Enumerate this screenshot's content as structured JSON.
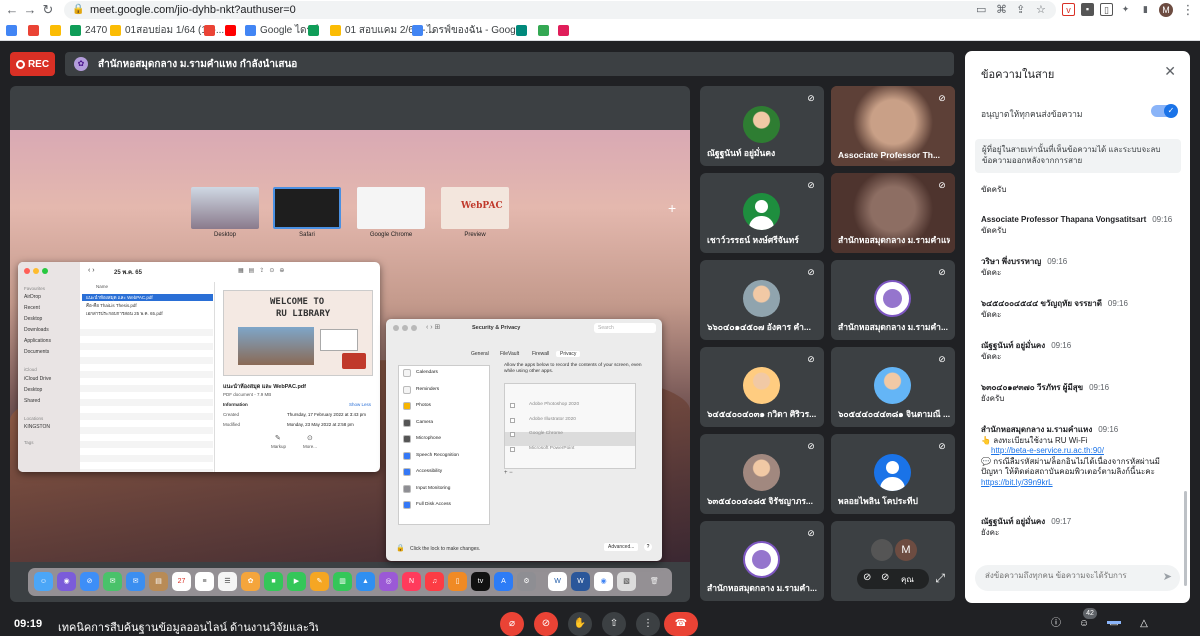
{
  "browser": {
    "url": "meet.google.com/jio-dyhb-nkt?authuser=0",
    "profile_initial": "M",
    "bookmarks": [
      {
        "label": "",
        "icon": "drive-icon",
        "color": "#4285f4"
      },
      {
        "label": "",
        "icon": "google-icon",
        "color": "#ea4335"
      },
      {
        "label": "",
        "icon": "drive-icon",
        "color": "#fbbc04"
      },
      {
        "label": "2470",
        "icon": "classroom-icon",
        "color": "#0f9d58"
      },
      {
        "label": "01สอบย่อม 1/64 (10-...",
        "icon": "drive-icon",
        "color": "#fbbc04"
      },
      {
        "label": "",
        "icon": "gmail-icon",
        "color": "#ea4335"
      },
      {
        "label": "",
        "icon": "youtube-icon",
        "color": "#ff0000"
      },
      {
        "label": "Google ไดรฟ์",
        "icon": "drive-icon",
        "color": "#4285f4"
      },
      {
        "label": "",
        "icon": "drive-icon",
        "color": "#0f9d58"
      },
      {
        "label": "01 สอบแคม 2/64 -...",
        "icon": "drive-icon",
        "color": "#fbbc04"
      },
      {
        "label": "ไดรฟ์ของฉัน - Googl...",
        "icon": "drive-icon",
        "color": "#4285f4"
      },
      {
        "label": "",
        "icon": "meet-icon",
        "color": "#00897b"
      },
      {
        "label": "",
        "icon": "maps-icon",
        "color": "#34a853"
      },
      {
        "label": "",
        "icon": "slack-icon",
        "color": "#e01e5a"
      }
    ]
  },
  "meet": {
    "rec_label": "REC",
    "presenter_bar": "สำนักหอสมุดกลาง ม.รามคำแหง กำลังนำเสนอ",
    "clock": "09:19",
    "meeting_title": "เทคนิคการสืบค้นฐานข้อมูลออนไลน์ ด้านงานวิจัยและวิทยา",
    "participant_count": "42",
    "self_label": "คุณ",
    "self_initial": "M"
  },
  "shared_screen": {
    "spaces": [
      "Desktop",
      "Safari",
      "Google Chrome",
      "Preview"
    ],
    "finder": {
      "title": "25 พ.ค. 65",
      "sidebar": [
        "Favourites",
        "AirDrop",
        "Recent",
        "Desktop",
        "Downloads",
        "Applications",
        "Documents",
        "iCloud",
        "iCloud Drive",
        "Desktop",
        "Shared",
        "Locations",
        "KINGSTON",
        "Tags"
      ],
      "column_header": "Name",
      "files": [
        "แนะนำห้องสมุด และ WebPAC.pdf",
        "คือ-คือ ThaiLis Thesis.pdf",
        "เอกสารประกอบการสอน 25 พ.ค. 65.pdf"
      ],
      "poster_line1": "WELCOME TO",
      "poster_line2": "RU LIBRARY",
      "preview_name": "แนะนำห้องสมุด และ WebPAC.pdf",
      "preview_type": "PDF document - 7.9 MB",
      "info_label": "Information",
      "show_less": "Show Less",
      "created_label": "Created",
      "created_value": "Thursday, 17 February 2022 at 3:43 pm",
      "modified_label": "Modified",
      "modified_value": "Monday, 23 May 2022 at 2:58 pm",
      "markup_label": "Markup",
      "more_label": "More..."
    },
    "security": {
      "title": "Security & Privacy",
      "search_placeholder": "Search",
      "tabs": [
        "General",
        "FileVault",
        "Firewall",
        "Privacy"
      ],
      "categories": [
        {
          "label": "Calendars",
          "color": "#f4f4f4"
        },
        {
          "label": "Reminders",
          "color": "#f4f4f4"
        },
        {
          "label": "Photos",
          "color": "#f7b500"
        },
        {
          "label": "Camera",
          "color": "#555555"
        },
        {
          "label": "Microphone",
          "color": "#555555"
        },
        {
          "label": "Speech Recognition",
          "color": "#3478f6"
        },
        {
          "label": "Accessibility",
          "color": "#3478f6"
        },
        {
          "label": "Input Monitoring",
          "color": "#8e8e93"
        },
        {
          "label": "Full Disk Access",
          "color": "#3478f6"
        }
      ],
      "description": "Allow the apps below to record the contents of your screen, even while using other apps.",
      "apps": [
        "Adobe Photoshop 2020",
        "Adobe Illustrator 2020",
        "Google Chrome",
        "Microsoft PowerPoint"
      ],
      "lock_text": "Click the lock to make changes.",
      "advanced": "Advanced...",
      "help": "?"
    },
    "webpac_title": "WebPAC"
  },
  "participants": [
    {
      "name": "ณัฐฐนันท์ อยู่มั่นคง",
      "avatar": "photo",
      "bg": "#3c4043",
      "color": "#2e7d32"
    },
    {
      "name": "Associate Professor Th...",
      "avatar": "video",
      "bg": "#5d4037",
      "color": "#c9a087"
    },
    {
      "name": "เชาว์วรรธน์ หงษ์ศรีจันทร์",
      "avatar": "default",
      "bg": "#3c4043",
      "color": "#1e8e3e"
    },
    {
      "name": "สำนักหอสมุดกลาง ม.รามคำแหง...",
      "avatar": "video",
      "bg": "#4e342e",
      "color": "#8d6e63"
    },
    {
      "name": "๖๖๐๔๐๑๔๕๐๗ อังคาร คำ...",
      "avatar": "photo",
      "bg": "#3c4043",
      "color": "#90a4ae"
    },
    {
      "name": "สำนักหอสมุดกลาง ม.รามคำ...",
      "avatar": "logo",
      "bg": "#3c4043",
      "color": "#ffffff"
    },
    {
      "name": "๖๔๕๔๐๐๔๐๓๑ กวิดา ศิริวร...",
      "avatar": "photo",
      "bg": "#3c4043",
      "color": "#ffcc80"
    },
    {
      "name": "๖๐๕๔๔๐๔๔๓๘๑ จินตามณี ...",
      "avatar": "photo",
      "bg": "#3c4043",
      "color": "#64b5f6"
    },
    {
      "name": "๖๓๕๔๐๐๔๐๘๕ จิรัชญาภร...",
      "avatar": "photo",
      "bg": "#3c4043",
      "color": "#a1887f"
    },
    {
      "name": "พลอยไพลิน โคประทีป",
      "avatar": "default",
      "bg": "#3c4043",
      "color": "#1a73e8"
    },
    {
      "name": "สำนักหอสมุดกลาง ม.รามคำ...",
      "avatar": "logo",
      "bg": "#3c4043",
      "color": "#ffffff"
    }
  ],
  "chat": {
    "title": "ข้อความในสาย",
    "allow_label": "อนุญาตให้ทุกคนส่งข้อความ",
    "notice": "ผู้ที่อยู่ในสายเท่านั้นที่เห็นข้อความได้ และระบบจะลบข้อความออกหลังจากการสาย",
    "input_placeholder": "ส่งข้อความถึงทุกคน ข้อความจะได้รับการ",
    "messages": [
      {
        "sender": "",
        "time": "",
        "text": "ขัดครับ"
      },
      {
        "sender": "Associate Professor Thapana Vongsatitsart",
        "time": "09:16",
        "text": "ขัดครับ"
      },
      {
        "sender": "วริษา พึ่งบรรหาญ",
        "time": "09:16",
        "text": "ขัดคะ"
      },
      {
        "sender": "๖๔๕๔๐๐๔๕๔๔ ขวัญฤทัย จรรยาดี",
        "time": "09:16",
        "text": "ขัดคะ"
      },
      {
        "sender": "ณัฐฐนันท์ อยู่มั่นคง",
        "time": "09:16",
        "text": "ขัดคะ"
      },
      {
        "sender": "๖๓๐๔๐๑๙๓๗๐ วีรภัทร ผู้มีสุข",
        "time": "09:16",
        "text": "ยังครับ"
      },
      {
        "sender": "สำนักหอสมุดกลาง ม.รามคำแหง",
        "time": "09:16",
        "text": "ลงทะเบียนใช้งาน RU Wi-Fi"
      },
      {
        "sender": "ณัฐฐนันท์ อยู่มั่นคง",
        "time": "09:17",
        "text": "ยังคะ"
      }
    ],
    "link1": "http://beta-e-service.ru.ac.th:90/",
    "msg_line2": "กรณีลืมรหัสผ่าน/ล็อกอินไม่ได้เนื่องจากรหัสผ่านมีปัญหา ให้ติดต่อสถาบันคอมพิวเตอร์ตามลิงก์นี้นะคะ",
    "link2": "https://bit.ly/39n9krL"
  }
}
